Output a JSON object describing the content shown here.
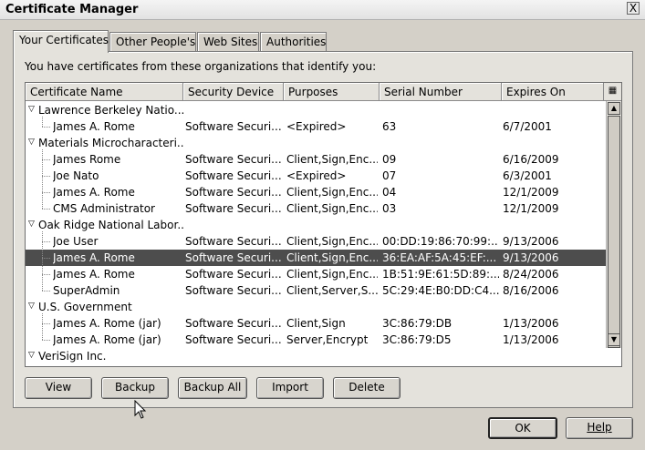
{
  "window": {
    "title": "Certificate Manager",
    "close_label": "X"
  },
  "tabs": [
    {
      "label": "Your Certificates",
      "active": true
    },
    {
      "label": "Other People's",
      "active": false
    },
    {
      "label": "Web Sites",
      "active": false
    },
    {
      "label": "Authorities",
      "active": false
    }
  ],
  "intro_text": "You have certificates from these organizations that identify you:",
  "columns": [
    "Certificate Name",
    "Security Device",
    "Purposes",
    "Serial Number",
    "Expires On"
  ],
  "rows": [
    {
      "type": "group",
      "name": "Lawrence Berkeley Natio..."
    },
    {
      "type": "cert",
      "name": "James A. Rome",
      "device": "Software Securi...",
      "purposes": "<Expired>",
      "serial": "63",
      "expires": "6/7/2001"
    },
    {
      "type": "group",
      "name": "Materials Microcharacteri..."
    },
    {
      "type": "cert",
      "name": "James Rome",
      "device": "Software Securi...",
      "purposes": "Client,Sign,Enc...",
      "serial": "09",
      "expires": "6/16/2009"
    },
    {
      "type": "cert",
      "name": "Joe Nato",
      "device": "Software Securi...",
      "purposes": "<Expired>",
      "serial": "07",
      "expires": "6/3/2001"
    },
    {
      "type": "cert",
      "name": "James A. Rome",
      "device": "Software Securi...",
      "purposes": "Client,Sign,Enc...",
      "serial": "04",
      "expires": "12/1/2009"
    },
    {
      "type": "cert",
      "name": "CMS Administrator",
      "device": "Software Securi...",
      "purposes": "Client,Sign,Enc...",
      "serial": "03",
      "expires": "12/1/2009"
    },
    {
      "type": "group",
      "name": "Oak Ridge National Labor..."
    },
    {
      "type": "cert",
      "name": "Joe User",
      "device": "Software Securi...",
      "purposes": "Client,Sign,Enc...",
      "serial": "00:DD:19:86:70:99:...",
      "expires": "9/13/2006"
    },
    {
      "type": "cert",
      "name": "James A. Rome",
      "device": "Software Securi...",
      "purposes": "Client,Sign,Enc...",
      "serial": "36:EA:AF:5A:45:EF:...",
      "expires": "9/13/2006",
      "selected": true
    },
    {
      "type": "cert",
      "name": "James A. Rome",
      "device": "Software Securi...",
      "purposes": "Client,Sign,Enc...",
      "serial": "1B:51:9E:61:5D:89:...",
      "expires": "8/24/2006"
    },
    {
      "type": "cert",
      "name": "SuperAdmin",
      "device": "Software Securi...",
      "purposes": "Client,Server,S...",
      "serial": "5C:29:4E:B0:DD:C4...",
      "expires": "8/16/2006"
    },
    {
      "type": "group",
      "name": "U.S. Government"
    },
    {
      "type": "cert",
      "name": "James A. Rome (jar)",
      "device": "Software Securi...",
      "purposes": "Client,Sign",
      "serial": "3C:86:79:DB",
      "expires": "1/13/2006"
    },
    {
      "type": "cert",
      "name": "James A. Rome (jar)",
      "device": "Software Securi...",
      "purposes": "Server,Encrypt",
      "serial": "3C:86:79:D5",
      "expires": "1/13/2006"
    },
    {
      "type": "group",
      "name": "VeriSign Inc."
    }
  ],
  "actions": [
    "View",
    "Backup",
    "Backup All",
    "Import",
    "Delete"
  ],
  "footer": {
    "ok_label": "OK",
    "help_label": "Help"
  }
}
